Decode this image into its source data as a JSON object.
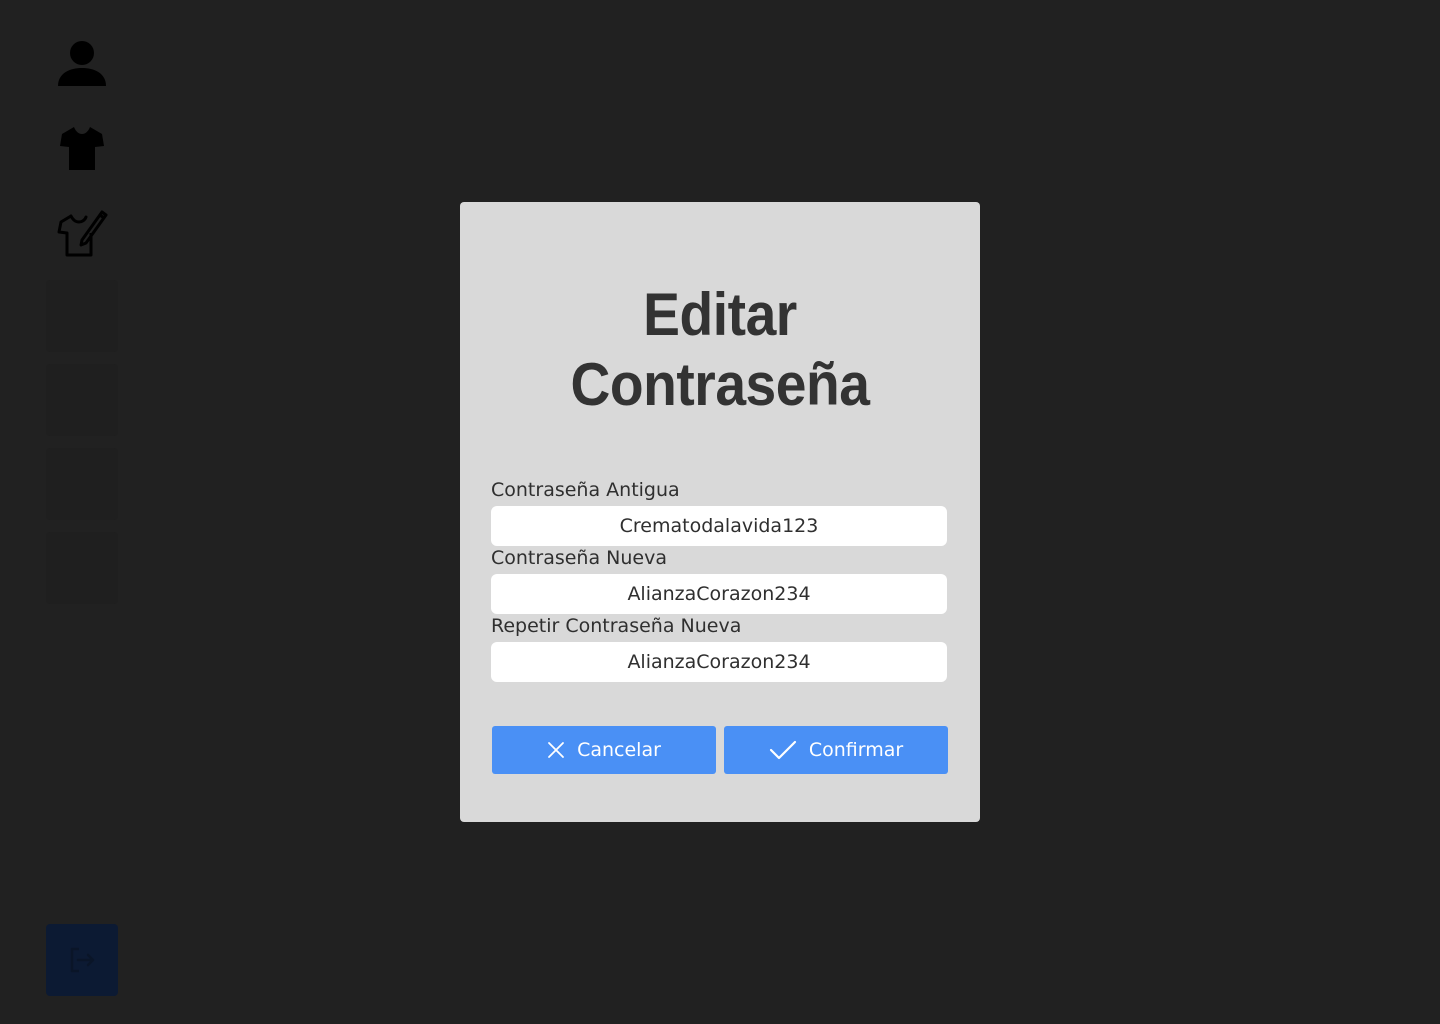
{
  "sidebar": {
    "items": [
      {
        "icon": "user-icon"
      },
      {
        "icon": "tshirt-icon"
      },
      {
        "icon": "tshirt-edit-icon"
      }
    ],
    "logout_icon": "logout-icon"
  },
  "modal": {
    "title_line1": "Editar",
    "title_line2": "Contraseña",
    "fields": [
      {
        "label": "Contraseña Antigua",
        "value": "Crematodalavida123"
      },
      {
        "label": "Contraseña Nueva",
        "value": "AlianzaCorazon234"
      },
      {
        "label": "Repetir Contraseña Nueva",
        "value": "AlianzaCorazon234"
      }
    ],
    "cancel_label": "Cancelar",
    "confirm_label": "Confirmar"
  },
  "colors": {
    "background": "#212121",
    "modal": "#d9d9d9",
    "accent": "#4a90f5",
    "text": "#333333"
  }
}
